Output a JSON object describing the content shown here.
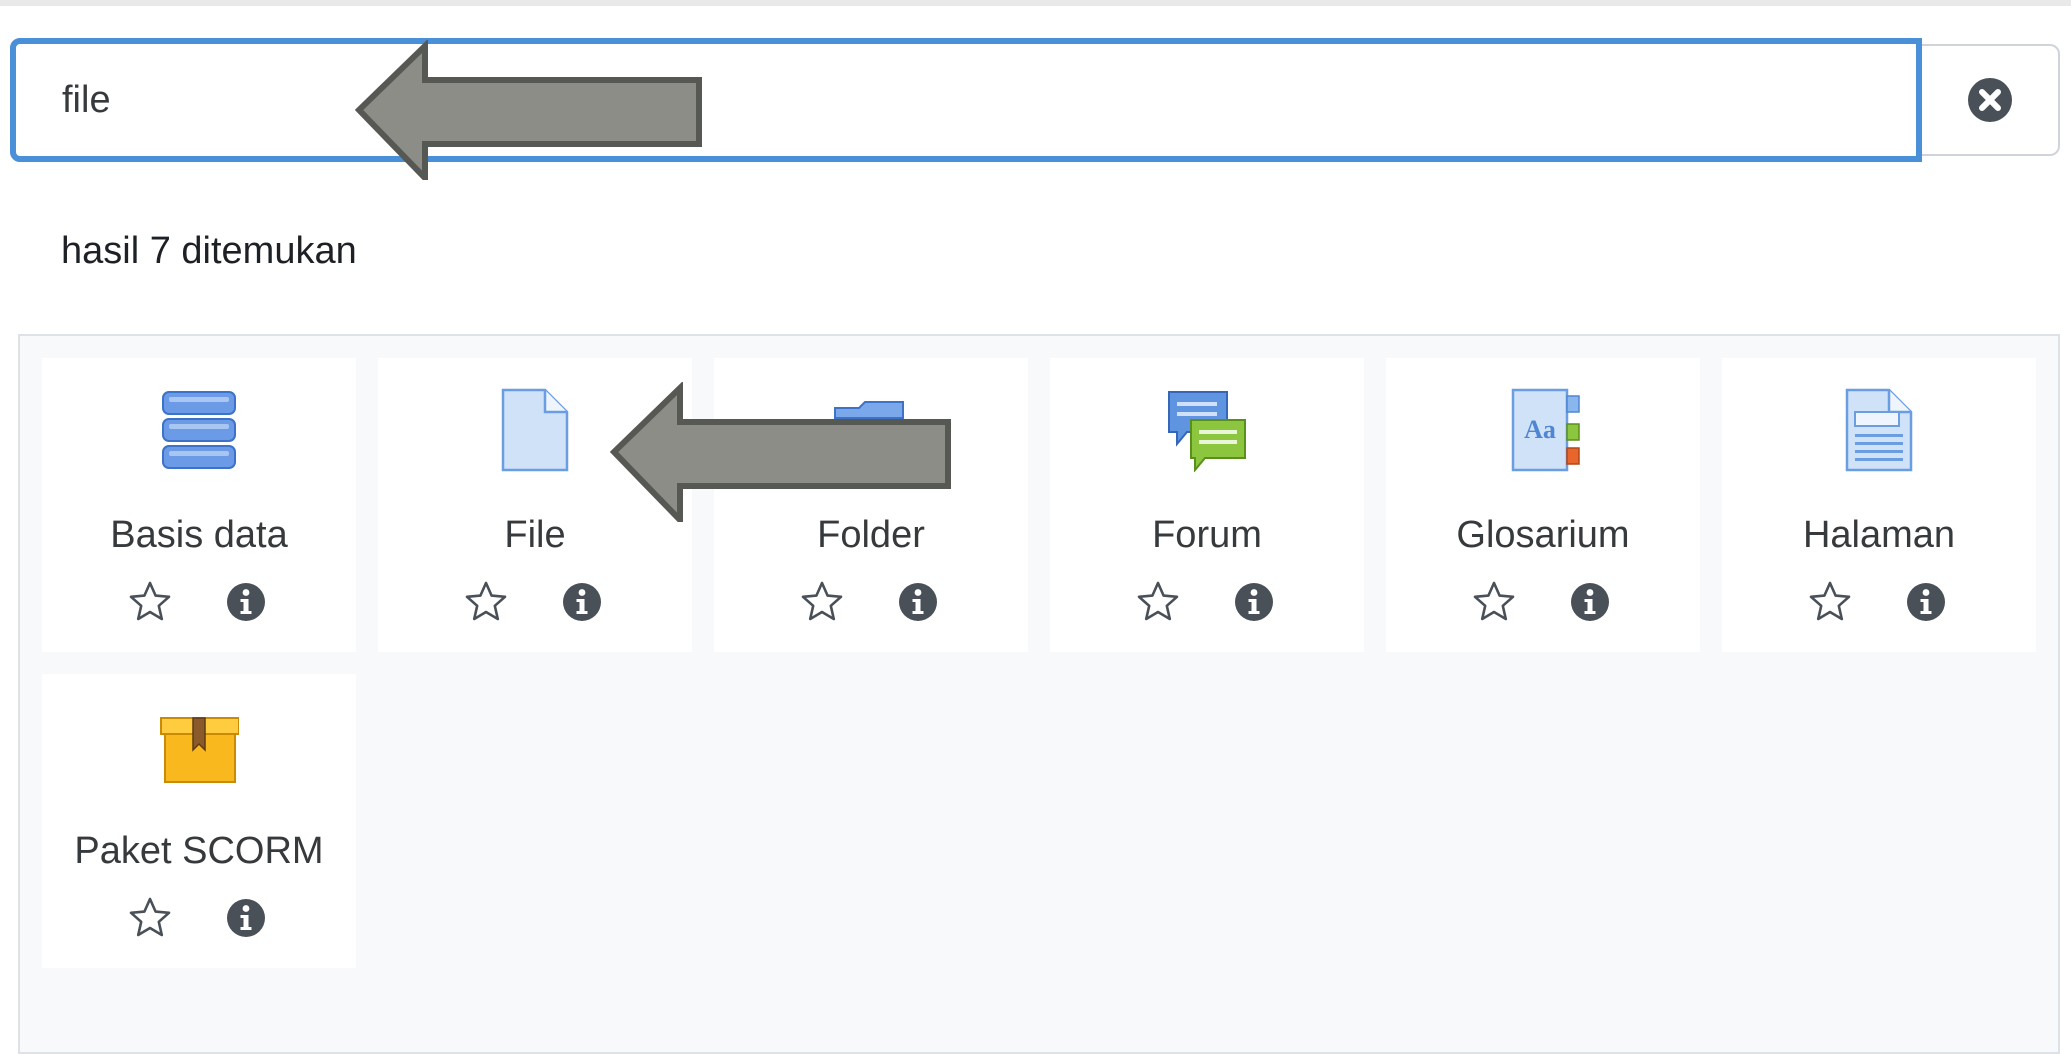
{
  "search": {
    "value": "file",
    "clear_icon": "times-circle-icon"
  },
  "results": {
    "count_text": "hasil 7 ditemukan"
  },
  "modules": [
    {
      "label": "Basis data",
      "icon": "database-icon"
    },
    {
      "label": "File",
      "icon": "file-icon"
    },
    {
      "label": "Folder",
      "icon": "folder-icon"
    },
    {
      "label": "Forum",
      "icon": "forum-icon"
    },
    {
      "label": "Glosarium",
      "icon": "glossary-icon"
    },
    {
      "label": "Halaman",
      "icon": "page-icon"
    },
    {
      "label": "Paket SCORM",
      "icon": "scorm-package-icon"
    }
  ],
  "colors": {
    "focus_border": "#4a90d9",
    "panel_bg": "#f8f9fa",
    "arrow_fill": "#8c8d87",
    "arrow_stroke": "#555853",
    "icon_dark": "#495057"
  }
}
